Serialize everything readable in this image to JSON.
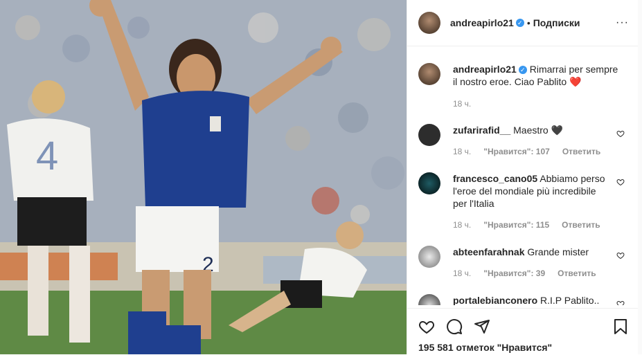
{
  "post": {
    "author": "andreapirlo21",
    "follow_label": "Подписки",
    "separator": "•",
    "more_label": "···",
    "caption": "Rimarrai per sempre il nostro eroe. Ciao Pablito",
    "caption_emoji": "❤️",
    "caption_time": "18 ч.",
    "likes_text": "195 581 отметок \"Нравится\"",
    "photo_jersey_numbers": [
      "4",
      "2"
    ]
  },
  "comments": [
    {
      "user": "zufarirafid__",
      "text": "Maestro 🖤",
      "time": "18 ч.",
      "likes": "\"Нравится\": 107",
      "reply": "Ответить"
    },
    {
      "user": "francesco_cano05",
      "text": "Abbiamo perso l'eroe del mondiale più incredibile per l'Italia",
      "time": "18 ч.",
      "likes": "\"Нравится\": 115",
      "reply": "Ответить"
    },
    {
      "user": "abteenfarahnak",
      "text": "Grande mister",
      "time": "18 ч.",
      "likes": "\"Нравится\": 39",
      "reply": "Ответить"
    },
    {
      "user": "portalebianconero",
      "text": "R.I.P Pablito..",
      "time": "",
      "likes": "",
      "reply": ""
    }
  ],
  "icons": {
    "like": "heart-icon",
    "comment": "comment-icon",
    "share": "share-icon",
    "save": "bookmark-icon",
    "verified": "verified-badge-icon"
  },
  "colors": {
    "verified": "#3897f0",
    "heart_emoji": "#ed4956",
    "text": "#262626",
    "muted": "#8e8e8e",
    "italy_jersey": "#1f3f8f"
  }
}
